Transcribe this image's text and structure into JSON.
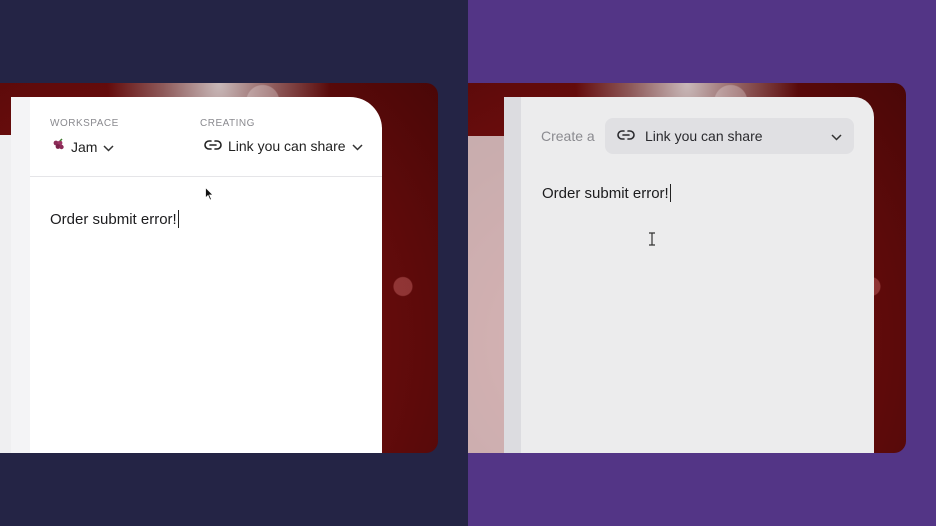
{
  "left_panel": {
    "workspace_label": "WORKSPACE",
    "workspace_value": "Jam",
    "creating_label": "CREATING",
    "creating_value": "Link you can share",
    "message": "Order submit error!"
  },
  "right_panel": {
    "create_label": "Create a",
    "dropdown_value": "Link you can share",
    "message": "Order submit error!"
  },
  "colors": {
    "left_bg": "#242445",
    "right_bg": "#533586",
    "card": "#ffffff"
  },
  "icons": [
    "grape-icon",
    "chevron-down-icon",
    "link-icon",
    "mouse-pointer-icon",
    "text-cursor-icon"
  ]
}
